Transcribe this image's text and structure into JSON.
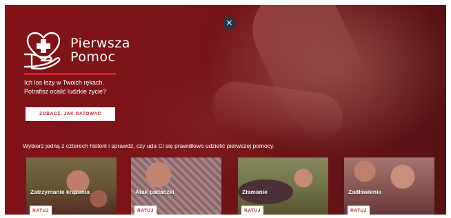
{
  "close": {
    "symbol": "×"
  },
  "logo": {
    "icon": "heart-hand-plus-icon",
    "line1": "Pierwsza",
    "line2": "Pomoc"
  },
  "hero": {
    "tagline_line1": "Ich los leży w Twoich rękach.",
    "tagline_line2": "Potrafisz ocalić ludzkie życie?",
    "cta_label": "ZOBACZ, JAK RATOWAĆ"
  },
  "intro": "Wybierz jedną z czterech historii i sprawdź, czy uda Ci się prawidłowo udzielić pierwszej pomocy.",
  "colors": {
    "accent": "#c8232b",
    "overlay": "#7d1a1c",
    "close_bg": "#2b3340"
  },
  "stories": [
    {
      "title": "Zatrzymanie krążenia",
      "button": "RATUJ"
    },
    {
      "title": "Atak padaczki",
      "button": "RATUJ"
    },
    {
      "title": "Złamanie",
      "button": "RATUJ"
    },
    {
      "title": "Zadławienie",
      "button": "RATUJ"
    }
  ]
}
